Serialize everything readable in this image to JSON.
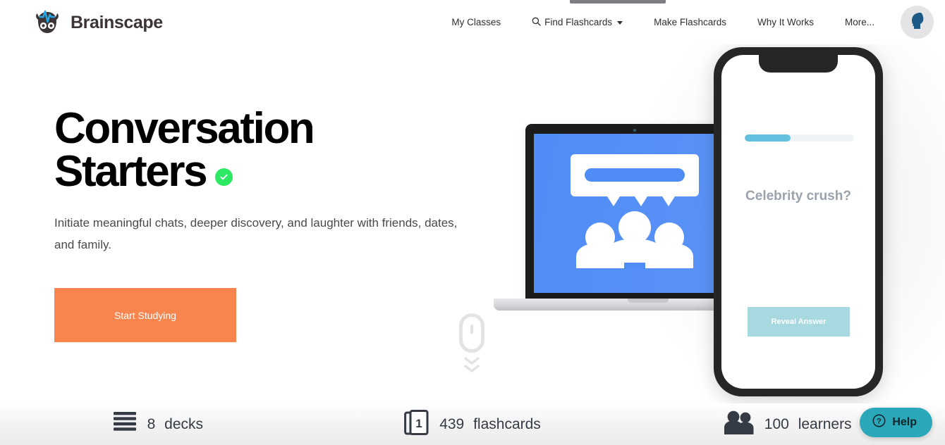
{
  "header": {
    "logo_text": "Brainscape",
    "logo_icon": "brainscape-brain-icon",
    "nav": [
      {
        "label": "My Classes",
        "icon": null,
        "caret": false
      },
      {
        "label": "Find Flashcards",
        "icon": "search-icon",
        "caret": true
      },
      {
        "label": "Make Flashcards",
        "icon": null,
        "caret": false
      },
      {
        "label": "Why It Works",
        "icon": null,
        "caret": false
      },
      {
        "label": "More...",
        "icon": null,
        "caret": false
      }
    ],
    "avatar_icon": "user-profile-head-icon"
  },
  "hero": {
    "title_line_1": "Conversation",
    "title_line_2": "Starters",
    "verified_icon": "verified-check-icon",
    "verified_color": "#2ce863",
    "subtitle": "Initiate meaningful chats, deeper discovery, and laughter with friends, dates, and family.",
    "cta_label": "Start Studying",
    "cta_color": "#f9854e",
    "scroll_cue_icon": "scroll-down-mouse-icon"
  },
  "devices": {
    "laptop": {
      "screen_color": "#4f8cf5",
      "screen_icon": "group-chat-speech-bubble-icon"
    },
    "phone": {
      "progress_percent": 42,
      "progress_fill_color": "#63c1df",
      "question_text": "Celebrity crush?",
      "reveal_label": "Reveal Answer",
      "reveal_color": "#a8d8e0"
    }
  },
  "stats": [
    {
      "icon": "deck-stack-icon",
      "value": "8",
      "unit": "decks"
    },
    {
      "icon": "flashcard-count-icon",
      "value": "439",
      "unit": "flashcards"
    },
    {
      "icon": "learners-people-icon",
      "value": "100",
      "unit": "learners"
    }
  ],
  "help_widget": {
    "label": "Help",
    "icon": "question-circle-icon",
    "color": "#2aa7b8"
  }
}
